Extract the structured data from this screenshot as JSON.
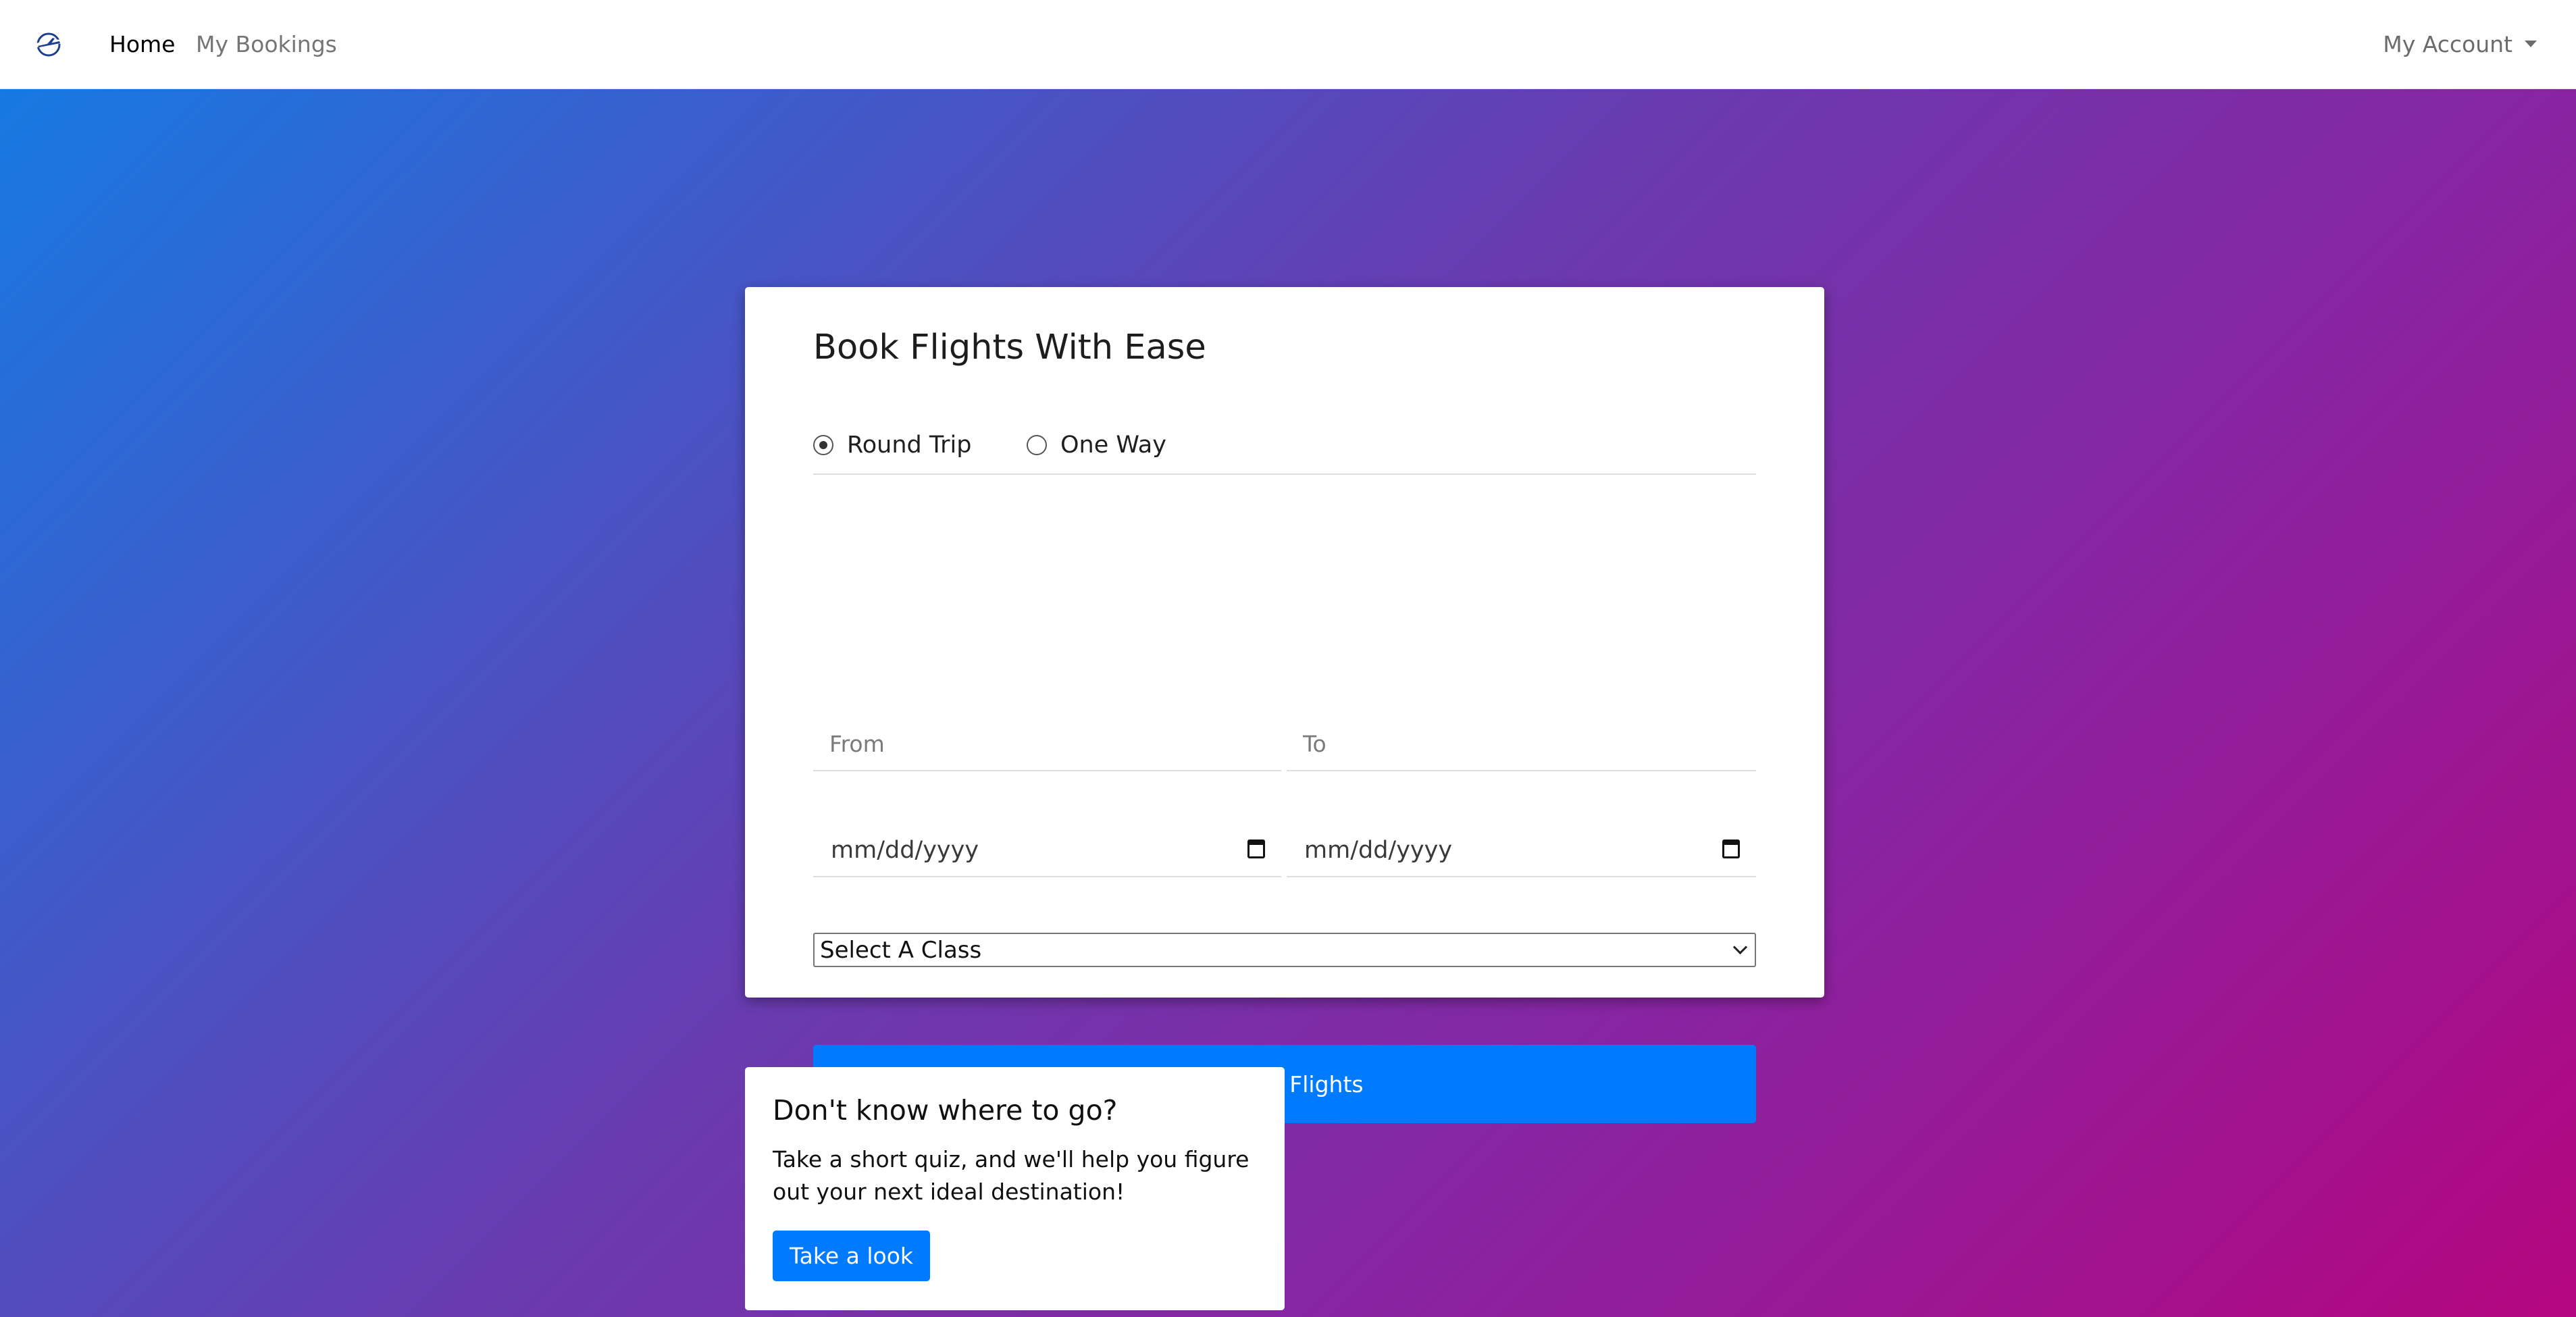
{
  "nav": {
    "logo_icon": "airplane-globe-icon",
    "items": [
      {
        "label": "Home"
      },
      {
        "label": "My Bookings"
      }
    ],
    "account_label": "My Account"
  },
  "booking_form": {
    "title": "Book Flights With Ease",
    "trip_type": {
      "options": [
        "Round Trip",
        "One Way"
      ],
      "selected": "Round Trip"
    },
    "from": {
      "placeholder": "From",
      "value": ""
    },
    "to": {
      "placeholder": "To",
      "value": ""
    },
    "depart_date": {
      "display": "mm/dd/yyyy"
    },
    "return_date": {
      "display": "mm/dd/yyyy"
    },
    "class_select": {
      "selected": "Select A Class"
    },
    "search_button": "Search Flights"
  },
  "quiz": {
    "title": "Don't know where to go?",
    "text": "Take a short quiz, and we'll help you figure out your next ideal destination!",
    "button": "Take a look"
  },
  "colors": {
    "accent": "#007bff",
    "gradient_start": "#1779e2",
    "gradient_end": "#b4067f"
  }
}
